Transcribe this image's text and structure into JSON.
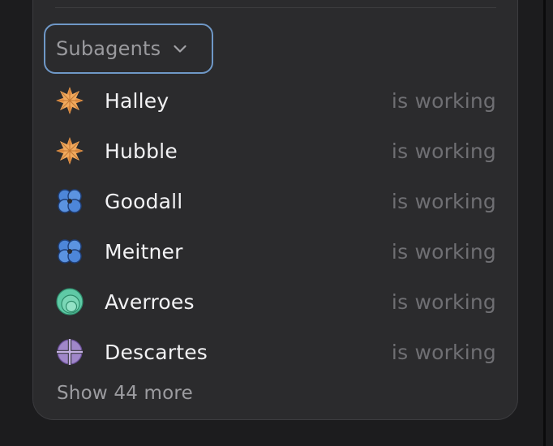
{
  "subagents": {
    "dropdown_label": "Subagents",
    "dropdown_icon": "chevron-down-icon",
    "agents": [
      {
        "name": "Halley",
        "status": "is working",
        "icon": "orange-star-icon",
        "color": "#e8974a"
      },
      {
        "name": "Hubble",
        "status": "is working",
        "icon": "orange-star-icon",
        "color": "#e8974a"
      },
      {
        "name": "Goodall",
        "status": "is working",
        "icon": "blue-clover-icon",
        "color": "#4d86d9"
      },
      {
        "name": "Meitner",
        "status": "is working",
        "icon": "blue-clover-icon",
        "color": "#4d86d9"
      },
      {
        "name": "Averroes",
        "status": "is working",
        "icon": "green-circles-icon",
        "color": "#5fcaa6"
      },
      {
        "name": "Descartes",
        "status": "is working",
        "icon": "purple-crosshair-icon",
        "color": "#a087c9"
      }
    ],
    "show_more_label": "Show 44 more"
  },
  "colors": {
    "background": "#1c1c1e",
    "panel": "#2b2b2d",
    "focus_ring": "#6f98c7",
    "primary_text": "#f2f2f4",
    "muted_text": "#6f6f73"
  }
}
